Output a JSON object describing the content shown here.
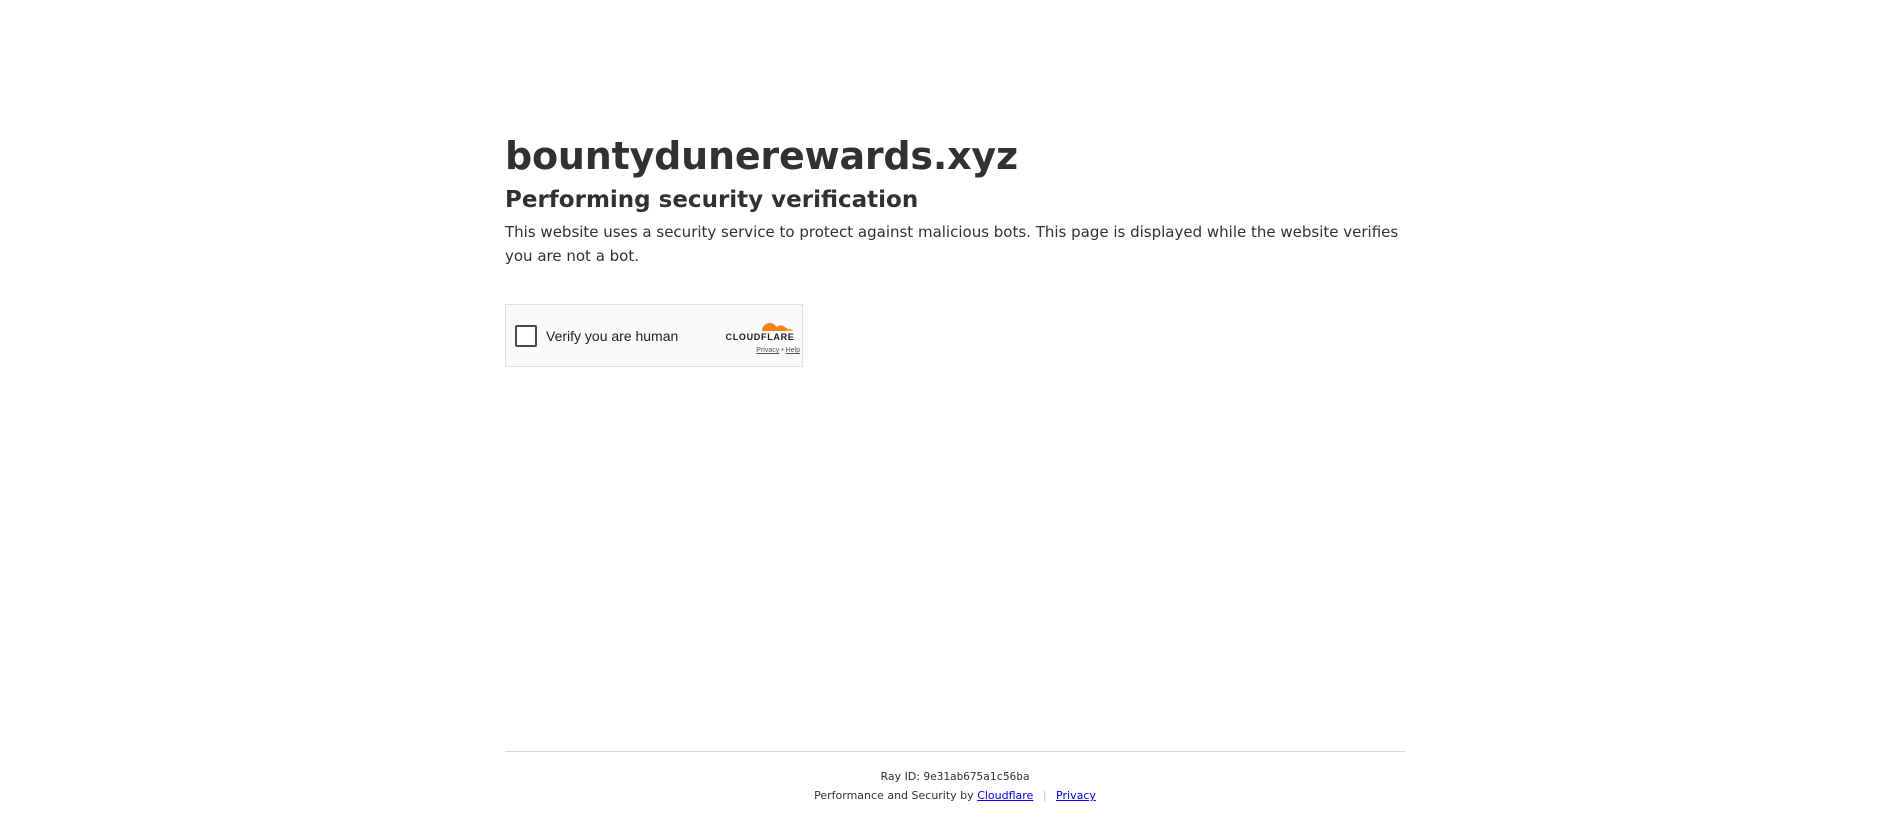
{
  "header": {
    "site_name": "bountydunerewards.xyz",
    "subtitle": "Performing security verification",
    "description": "This website uses a security service to protect against malicious bots. This page is displayed while the website verifies you are not a bot."
  },
  "widget": {
    "checkbox_label": "Verify you are human",
    "brand": "CLOUDFLARE",
    "privacy_link": "Privacy",
    "link_separator": "•",
    "help_link": "Help",
    "icons": [
      "checkbox-icon",
      "cloudflare-logo-icon"
    ],
    "colors": {
      "cloud_orange": "#f6821f",
      "cloud_light": "#fbad41"
    }
  },
  "footer": {
    "ray_label": "Ray ID:",
    "ray_id": "9e31ab675a1c56ba",
    "perf_text": "Performance and Security by",
    "cloudflare_link": "Cloudflare",
    "separator": "|",
    "privacy_link": "Privacy",
    "link_color": "#0000ee"
  }
}
